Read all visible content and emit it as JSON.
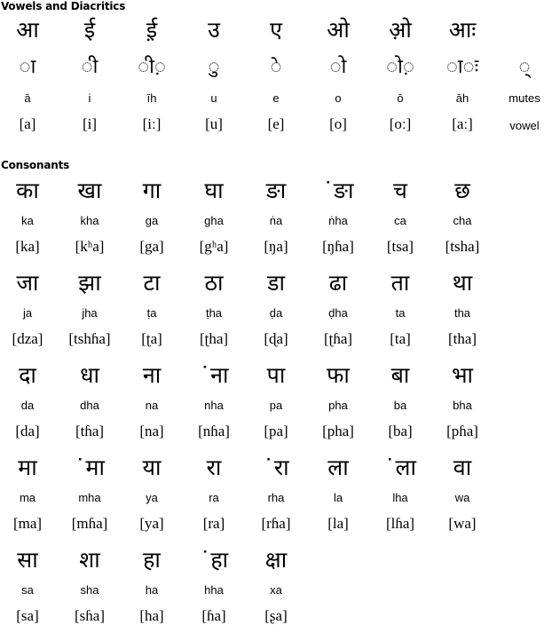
{
  "vowels": {
    "title": "Vowels and Diacritics",
    "columns": [
      {
        "letter": "आ",
        "diacritic": "◌ा",
        "translit": "ā",
        "ipa": "[a]"
      },
      {
        "letter": "ई",
        "diacritic": "◌ी",
        "translit": "i",
        "ipa": "[i]"
      },
      {
        "letter": "ई़",
        "diacritic": "◌ी◌़",
        "translit": "īh",
        "ipa": "[iː]"
      },
      {
        "letter": "उ",
        "diacritic": "◌ु",
        "translit": "u",
        "ipa": "[u]"
      },
      {
        "letter": "ए",
        "diacritic": "◌े",
        "translit": "e",
        "ipa": "[e]"
      },
      {
        "letter": "ओ",
        "diacritic": "◌ो",
        "translit": "o",
        "ipa": "[o]"
      },
      {
        "letter": "ओ़",
        "diacritic": "◌ो◌़",
        "translit": "ō",
        "ipa": "[oː]"
      },
      {
        "letter": "आः",
        "diacritic": "◌ा◌ः",
        "translit": "āh",
        "ipa": "[aː]"
      },
      {
        "letter": "",
        "diacritic": "◌्",
        "translit": "mutes",
        "ipa": "vowel"
      }
    ]
  },
  "consonants": {
    "title": "Consonants",
    "rows": [
      [
        {
          "letter": "का",
          "translit": "ka",
          "ipa": "[ka]"
        },
        {
          "letter": "खा",
          "translit": "kha",
          "ipa": "[kʰa]"
        },
        {
          "letter": "गा",
          "translit": "ga",
          "ipa": "[ga]"
        },
        {
          "letter": "घा",
          "translit": "gha",
          "ipa": "[gʰa]"
        },
        {
          "letter": "ङा",
          "translit": "ṅa",
          "ipa": "[ŋa]"
        },
        {
          "letter": "˙ङा",
          "translit": "ṅha",
          "ipa": "[ŋɦa]"
        },
        {
          "letter": "च",
          "translit": "ca",
          "ipa": "[tsa]"
        },
        {
          "letter": "छ",
          "translit": "cha",
          "ipa": "[tsha]"
        }
      ],
      [
        {
          "letter": "जा",
          "translit": "ja",
          "ipa": "[dza]"
        },
        {
          "letter": "झा",
          "translit": "jha",
          "ipa": "[tshɦa]"
        },
        {
          "letter": "टा",
          "translit": "ṭa",
          "ipa": "[ʈa]"
        },
        {
          "letter": "ठा",
          "translit": "ṭha",
          "ipa": "[ʈha]"
        },
        {
          "letter": "डा",
          "translit": "ḍa",
          "ipa": "[ɖa]"
        },
        {
          "letter": "ढा",
          "translit": "ḍha",
          "ipa": "[ʈɦa]"
        },
        {
          "letter": "ता",
          "translit": "ta",
          "ipa": "[ta]"
        },
        {
          "letter": "था",
          "translit": "tha",
          "ipa": "[tha]"
        }
      ],
      [
        {
          "letter": "दा",
          "translit": "da",
          "ipa": "[da]"
        },
        {
          "letter": "धा",
          "translit": "dha",
          "ipa": "[tɦa]"
        },
        {
          "letter": "ना",
          "translit": "na",
          "ipa": "[na]"
        },
        {
          "letter": "˙ना",
          "translit": "nha",
          "ipa": "[nɦa]"
        },
        {
          "letter": "पा",
          "translit": "pa",
          "ipa": "[pa]"
        },
        {
          "letter": "फा",
          "translit": "pha",
          "ipa": "[pha]"
        },
        {
          "letter": "बा",
          "translit": "ba",
          "ipa": "[ba]"
        },
        {
          "letter": "भा",
          "translit": "bha",
          "ipa": "[pɦa]"
        }
      ],
      [
        {
          "letter": "मा",
          "translit": "ma",
          "ipa": "[ma]"
        },
        {
          "letter": "˙मा",
          "translit": "mha",
          "ipa": "[mɦa]"
        },
        {
          "letter": "या",
          "translit": "ya",
          "ipa": "[ya]"
        },
        {
          "letter": "रा",
          "translit": "ra",
          "ipa": "[ra]"
        },
        {
          "letter": "˙रा",
          "translit": "rha",
          "ipa": "[rɦa]"
        },
        {
          "letter": "ला",
          "translit": "la",
          "ipa": "[la]"
        },
        {
          "letter": "˙ला",
          "translit": "lha",
          "ipa": "[lɦa]"
        },
        {
          "letter": "वा",
          "translit": "wa",
          "ipa": "[wa]"
        }
      ],
      [
        {
          "letter": "सा",
          "translit": "sa",
          "ipa": "[sa]"
        },
        {
          "letter": "शा",
          "translit": "sha",
          "ipa": "[sɦa]"
        },
        {
          "letter": "हा",
          "translit": "ha",
          "ipa": "[ha]"
        },
        {
          "letter": "˙हा",
          "translit": "hha",
          "ipa": "[ɦa]"
        },
        {
          "letter": "क्षा",
          "translit": "xa",
          "ipa": "[ʂa]"
        }
      ]
    ]
  }
}
